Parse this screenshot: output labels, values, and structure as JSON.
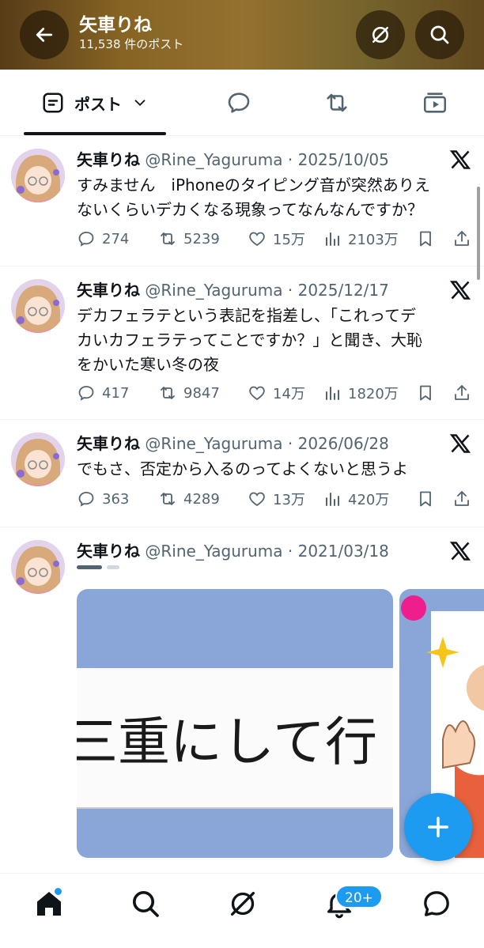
{
  "header": {
    "name": "矢車りね",
    "post_count": "11,538 件のポスト"
  },
  "tabs": {
    "posts_label": "ポスト"
  },
  "posts": [
    {
      "display_name": "矢車りね",
      "handle_date": "@Rine_Yaguruma · 2025/10/05",
      "text_line1": "すみません　iPhoneのタイピング音が突然ありえ",
      "text_line2": "ないくらいデカくなる現象ってなんなんですか？",
      "replies": "274",
      "reposts": "5239",
      "likes": "15万",
      "views": "2103万"
    },
    {
      "display_name": "矢車りね",
      "handle_date": "@Rine_Yaguruma · 2025/12/17",
      "text_line1": "デカフェラテという表記を指差し、「これってデ",
      "text_line2": "カいカフェラテってことですか？」と聞き、大恥",
      "text_line3": "をかいた寒い冬の夜",
      "replies": "417",
      "reposts": "9847",
      "likes": "14万",
      "views": "1820万"
    },
    {
      "display_name": "矢車りね",
      "handle_date": "@Rine_Yaguruma · 2026/06/28",
      "text_line1": "でもさ、否定から入るのってよくないと思うよ",
      "replies": "363",
      "reposts": "4289",
      "likes": "13万",
      "views": "420万"
    },
    {
      "display_name": "矢車りね",
      "handle_date": "@Rine_Yaguruma · 2021/03/18",
      "media_text": "三重にして行"
    }
  ],
  "nav": {
    "notifications_badge": "20+"
  },
  "colors": {
    "accent": "#1d9bf0",
    "text": "#0f1419",
    "muted": "#536471"
  }
}
